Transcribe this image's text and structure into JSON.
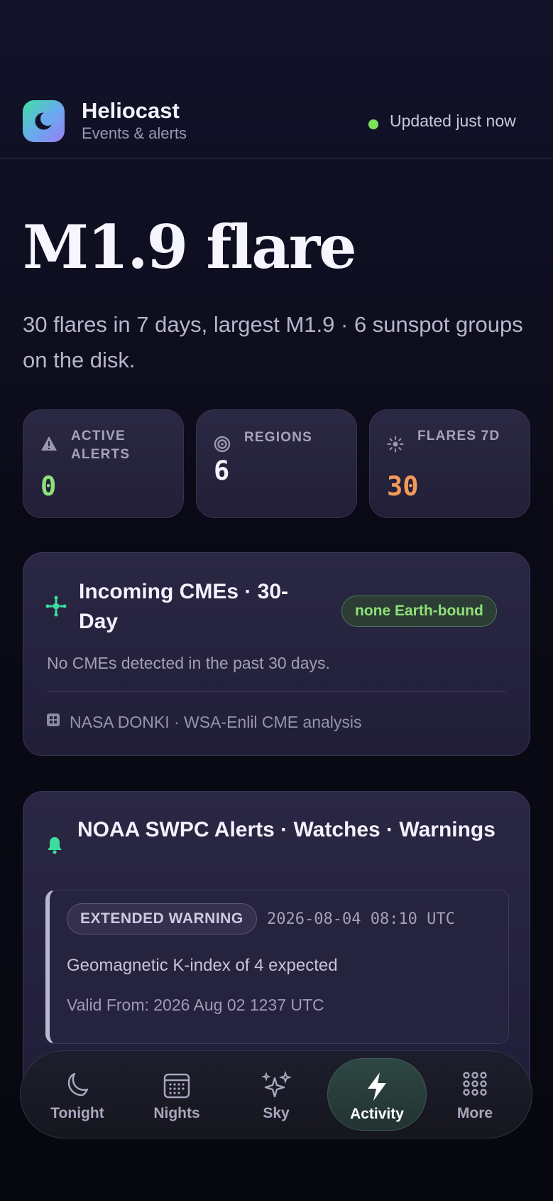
{
  "app": {
    "title": "Heliocast",
    "subtitle": "Events & alerts",
    "status": "Updated just now",
    "status_color": "#7ee05a"
  },
  "hero": {
    "title": "M1.9 flare",
    "summary": "30 flares in 7 days, largest M1.9 · 6 sunspot groups on the disk."
  },
  "stats": [
    {
      "icon": "warning-icon",
      "label": "ACTIVE ALERTS",
      "value": "0",
      "color": "#8fe07a"
    },
    {
      "icon": "target-icon",
      "label": "REGIONS",
      "value": "6",
      "color": "#f4f2fb"
    },
    {
      "icon": "sun-icon",
      "label": "FLARES 7D",
      "value": "30",
      "color": "#f29a5a"
    }
  ],
  "cme_card": {
    "icon": "cme-burst-icon",
    "title": "Incoming CMEs · 30-Day",
    "badge": "none Earth-bound",
    "message": "No CMEs detected in the past 30 days.",
    "source_icon": "grid-icon",
    "source": "NASA DONKI · WSA-Enlil CME analysis"
  },
  "alerts_card": {
    "icon": "bell-icon",
    "title": "NOAA SWPC Alerts · Watches · Warnings",
    "items": [
      {
        "badge": "EXTENDED WARNING",
        "time": "2026-08-04 08:10 UTC",
        "message": "Geomagnetic K-index of 4 expected",
        "valid": "Valid From: 2026 Aug 02 1237 UTC"
      }
    ]
  },
  "nav": {
    "items": [
      {
        "icon": "moon-icon",
        "label": "Tonight"
      },
      {
        "icon": "calendar-icon",
        "label": "Nights"
      },
      {
        "icon": "sparkles-icon",
        "label": "Sky"
      },
      {
        "icon": "lightning-icon",
        "label": "Activity"
      },
      {
        "icon": "grid-dots-icon",
        "label": "More"
      }
    ],
    "active": "Activity"
  }
}
